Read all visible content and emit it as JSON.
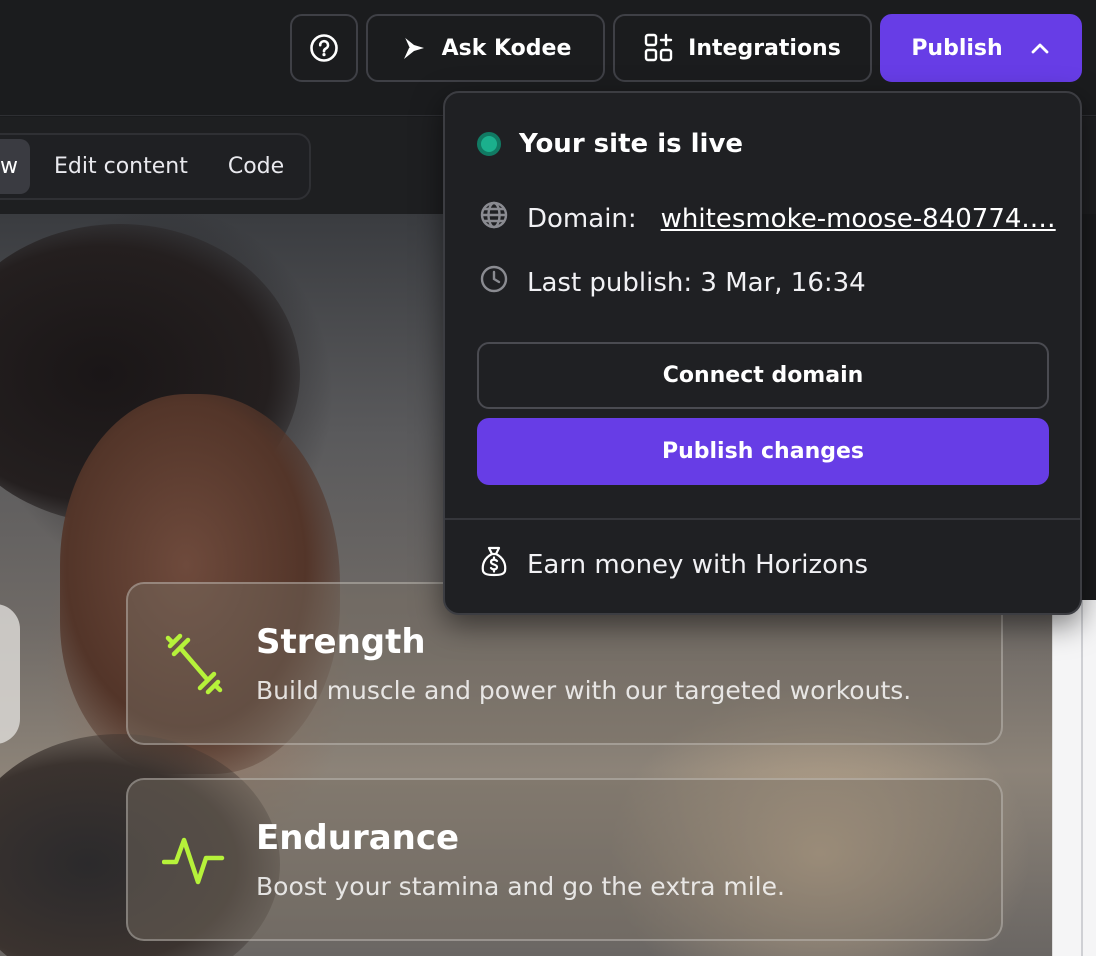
{
  "header": {
    "help_icon": "question-circle-icon",
    "ask_kodee_label": "Ask Kodee",
    "integrations_label": "Integrations",
    "publish_label": "Publish",
    "accent_color": "#673de6"
  },
  "view_tabs": {
    "active_partial": "w",
    "edit_content": "Edit content",
    "code": "Code"
  },
  "publish_dropdown": {
    "status": "Your site is live",
    "status_color": "#1bb08d",
    "domain_label": "Domain:",
    "domain_value": "whitesmoke-moose-840774.…",
    "last_publish": "Last publish: 3 Mar, 16:34",
    "connect_domain": "Connect domain",
    "publish_changes": "Publish changes",
    "earn_money": "Earn money with Horizons"
  },
  "features": [
    {
      "title": "Strength",
      "description": "Build muscle and power with our targeted workouts.",
      "icon": "dumbbell-icon"
    },
    {
      "title": "Endurance",
      "description": "Boost your stamina and go the extra mile.",
      "icon": "pulse-icon"
    }
  ],
  "feature_icon_color": "#b6f23a"
}
